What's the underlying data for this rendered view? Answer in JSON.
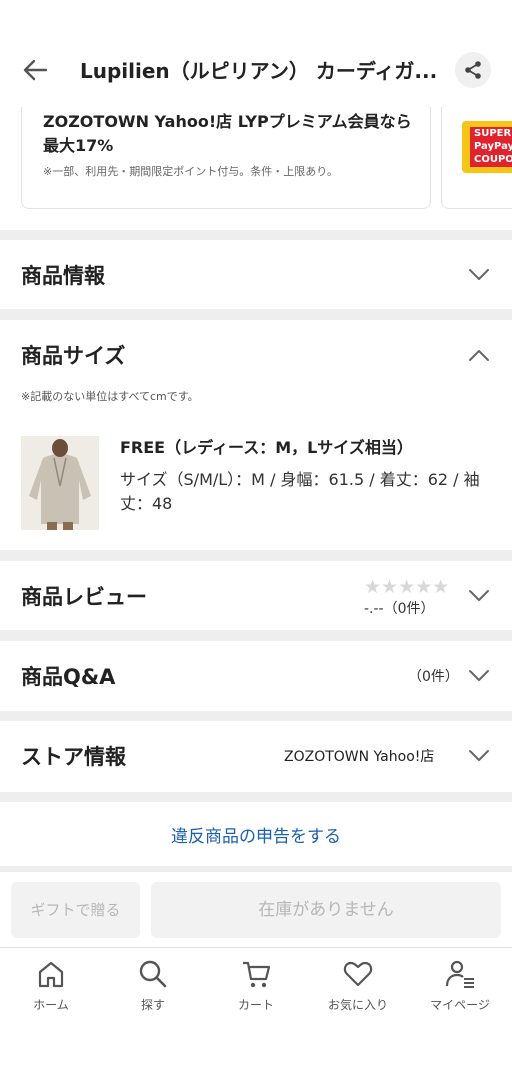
{
  "header": {
    "title": "Lupilien（ルピリアン） カーディガ..."
  },
  "promo": {
    "title": "ZOZOTOWN Yahoo!店 LYPプレミアム会員なら最大17%",
    "note": "※一部、利用先・期間限定ポイント付与。条件・上限あり。",
    "coupon_text": "SUPER PayPay COUPON"
  },
  "sections": {
    "product_info": "商品情報",
    "product_size": "商品サイズ",
    "size_note": "※記載のない単位はすべてcmです。",
    "size_name": "FREE（レディース：M，Lサイズ相当）",
    "size_detail": "サイズ（S/M/L）：M / 身幅：61.5 / 着丈：62 / 袖丈：48",
    "reviews": "商品レビュー",
    "stars": "★★★★★",
    "rating": "-.--（0件）",
    "qa": "商品Q&A",
    "qa_count": "（0件）",
    "store": "ストア情報",
    "store_name": "ZOZOTOWN Yahoo!店"
  },
  "report_link": "違反商品の申告をする",
  "actions": {
    "gift": "ギフトで贈る",
    "out_of_stock": "在庫がありません"
  },
  "bottom_nav": [
    {
      "label": "ホーム",
      "icon": "home-icon"
    },
    {
      "label": "探す",
      "icon": "search-icon"
    },
    {
      "label": "カート",
      "icon": "cart-icon"
    },
    {
      "label": "お気に入り",
      "icon": "heart-icon"
    },
    {
      "label": "マイページ",
      "icon": "user-icon"
    }
  ]
}
